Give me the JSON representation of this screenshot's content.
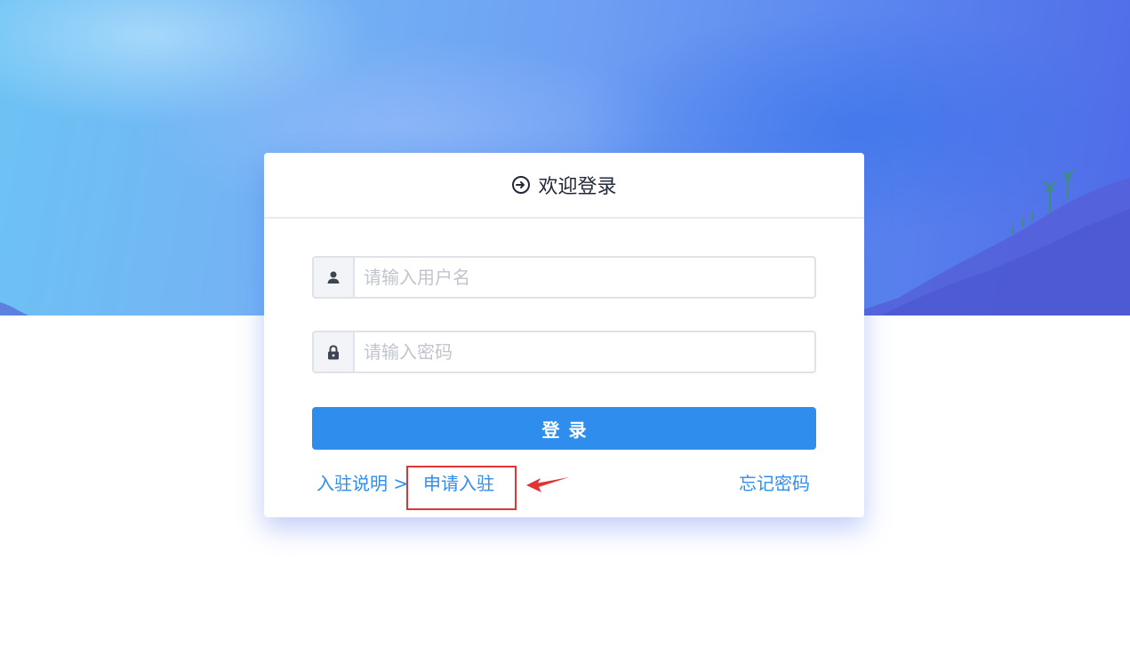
{
  "header": {
    "title": "欢迎登录",
    "icon": "login-icon"
  },
  "form": {
    "username": {
      "placeholder": "请输入用户名",
      "value": "",
      "icon": "user-icon"
    },
    "password": {
      "placeholder": "请输入密码",
      "value": "",
      "icon": "lock-icon"
    },
    "submit_label": "登录"
  },
  "links": {
    "intro": "入驻说明 >",
    "apply": "申请入驻",
    "forgot": "忘记密码"
  },
  "colors": {
    "accent": "#2f8eed",
    "annotation": "#e13434",
    "title_text": "#222a3a"
  }
}
